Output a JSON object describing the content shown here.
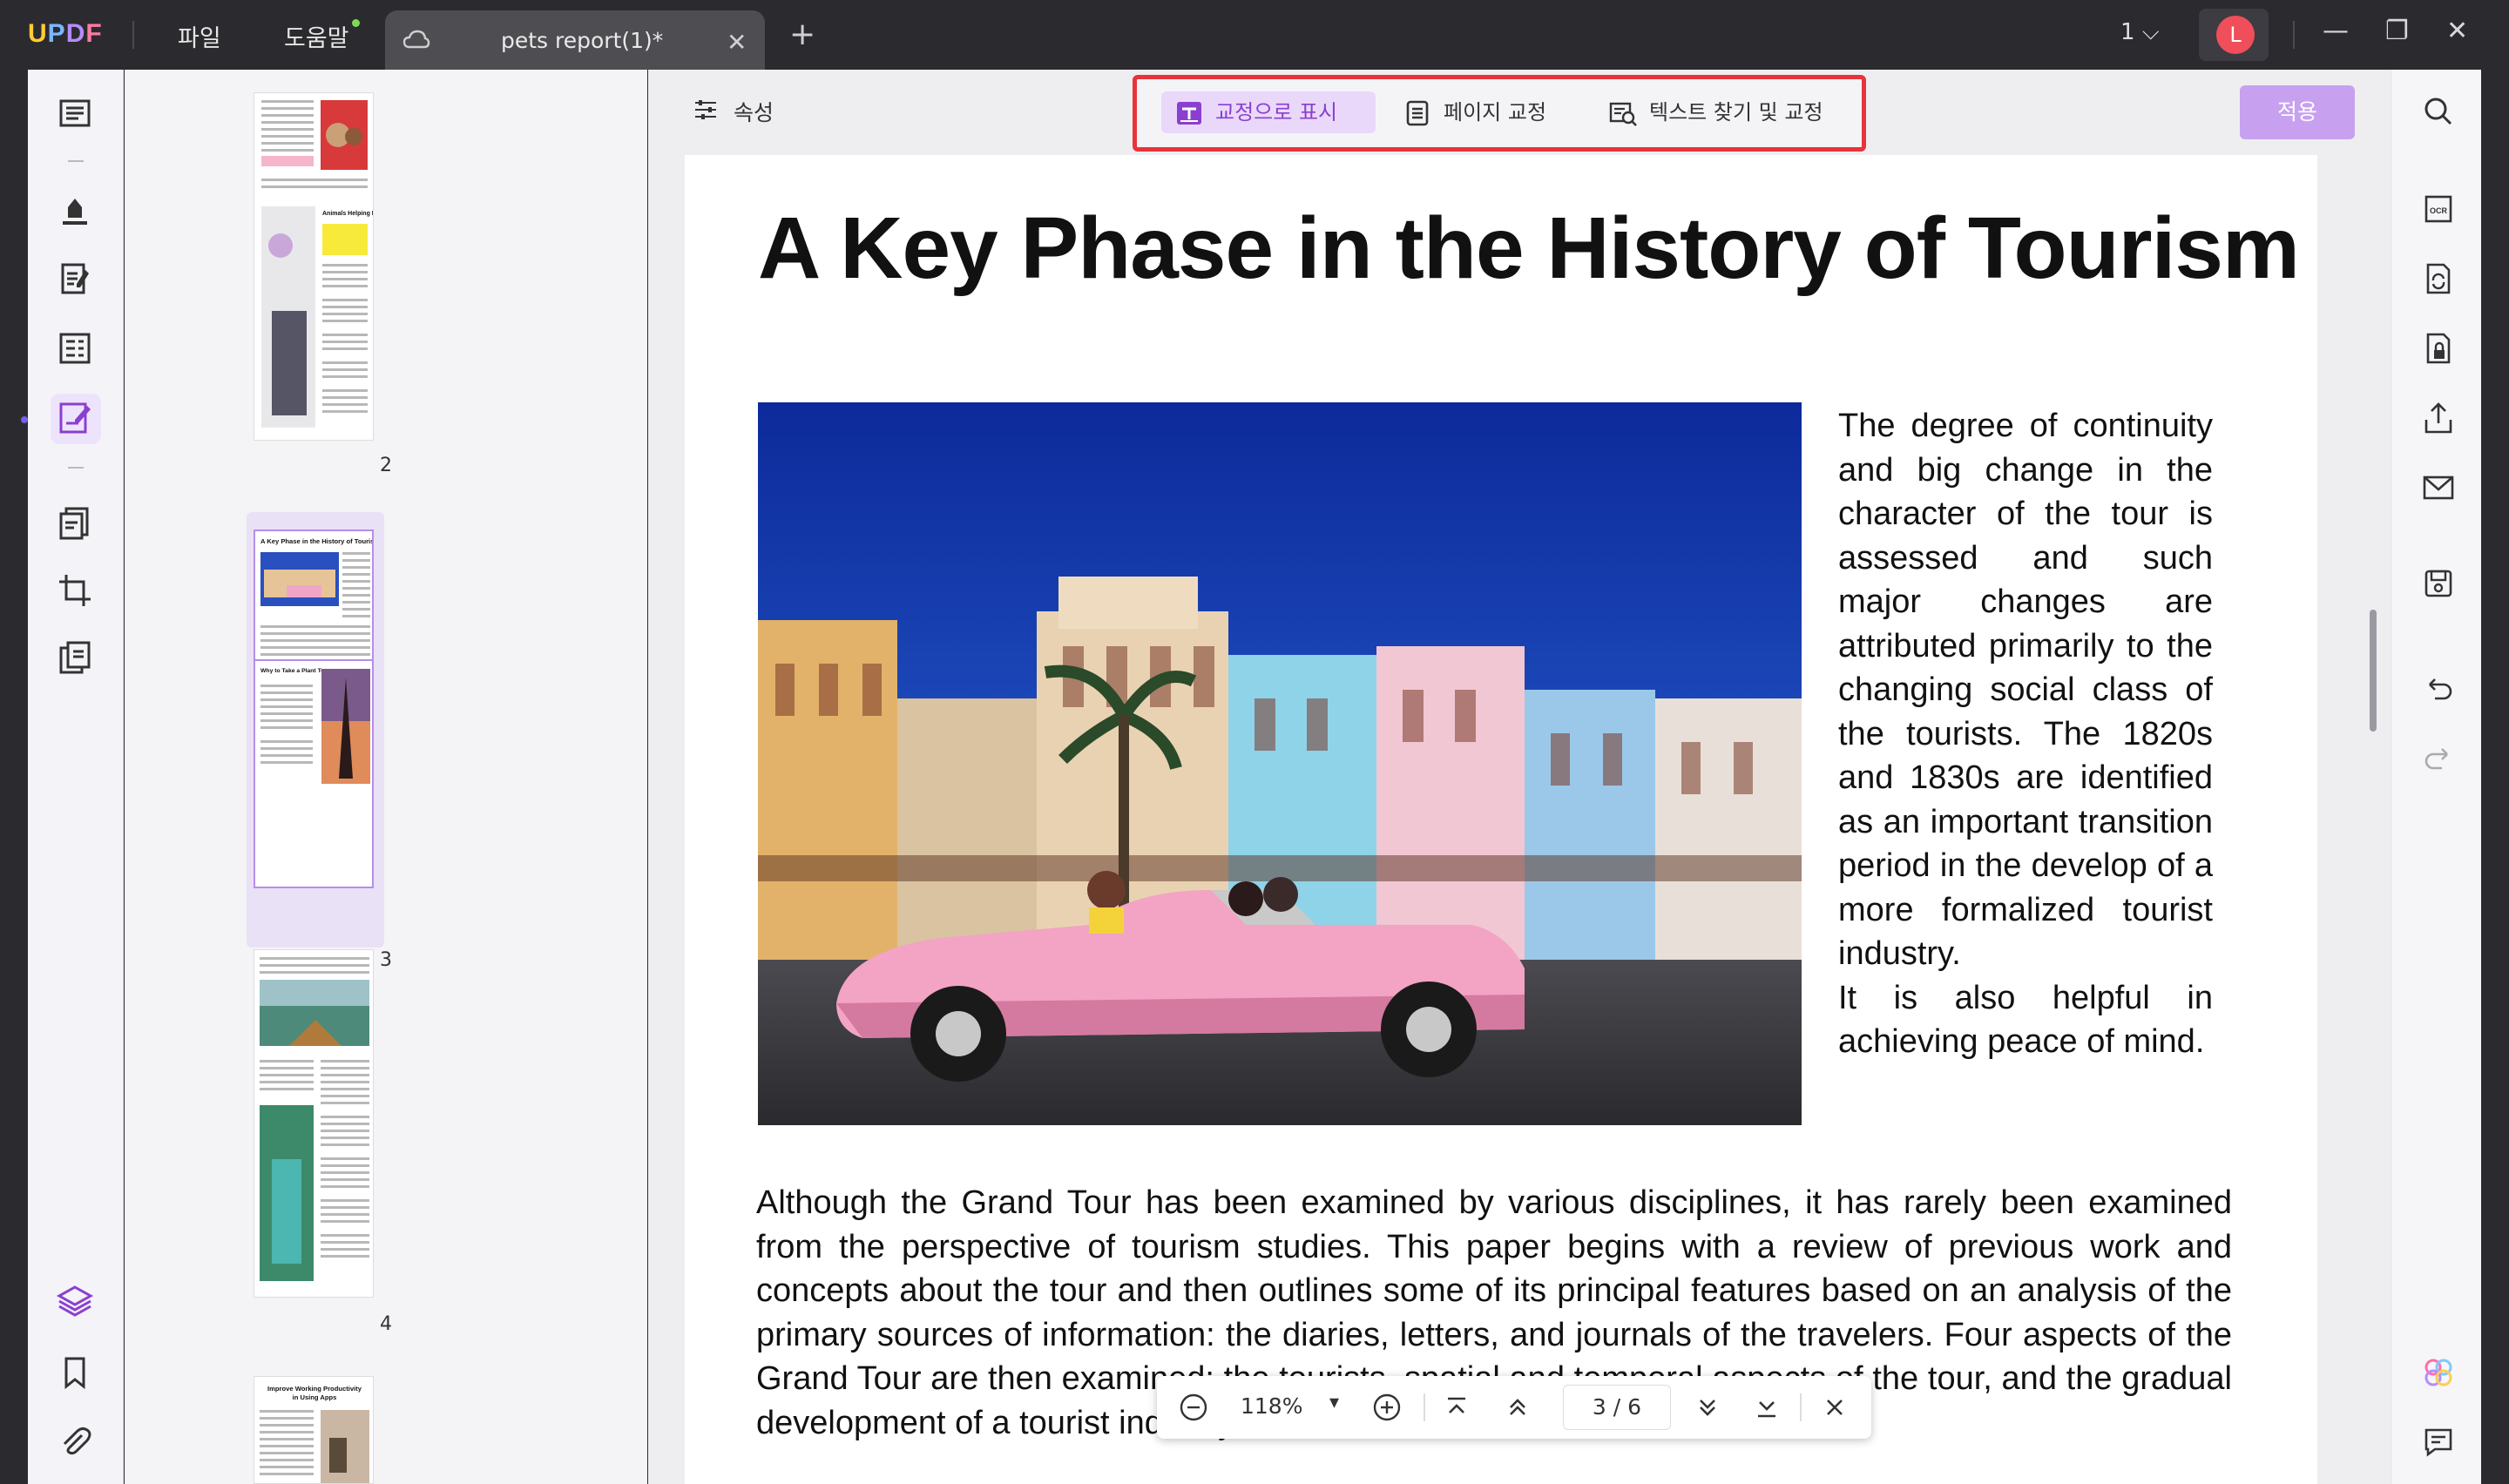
{
  "app": {
    "logo": "UPDF",
    "menu": [
      "파일",
      "도움말"
    ],
    "tab_title": "pets report(1)*",
    "page_selector": "1",
    "avatar_letter": "L"
  },
  "toolbar": {
    "properties": "속성",
    "buttons": [
      "교정으로 표시",
      "페이지 교정",
      "텍스트 찾기 및 교정"
    ],
    "apply": "적용"
  },
  "thumbnails": {
    "labels": [
      "2",
      "3",
      "4"
    ],
    "page3_title": "A Key Phase in the History of Tourism",
    "page3_sub": "Why to Take a Plant Tour",
    "page2_sub": "Animals Helping People",
    "page5_title": "Improve Working Productivity in Using Apps"
  },
  "document": {
    "heading": "A Key Phase in the History of Tourism",
    "side_paragraph_1": "The degree of continuity and big change in the character of the tour is assessed and such major changes are attributed primarily to the changing social class of the tourists. The 1820s and 1830s are identified as an important transition period in the develop of a more formalized tourist industry.",
    "side_paragraph_2": "It is also helpful in achieving peace of mind.",
    "body_paragraph": "Although the Grand Tour has been examined by various disciplines, it has rarely been examined from the perspective of tourism studies. This paper begins with a review of previous work and concepts about the tour and then outlines some of its principal features based on an analysis of the primary sources of information: the diaries, letters, and journals of the travelers. Four aspects of the Grand Tour are then examined: the tourists, spatial and temporal aspects of the tour, and the gradual development of a tourist industry."
  },
  "zoom": {
    "level": "118%",
    "page_indicator": "3 / 6"
  },
  "colors": {
    "accent": "#8a3fd0",
    "highlight_box": "#e8333a",
    "apply_bg": "#c7a1ef"
  }
}
